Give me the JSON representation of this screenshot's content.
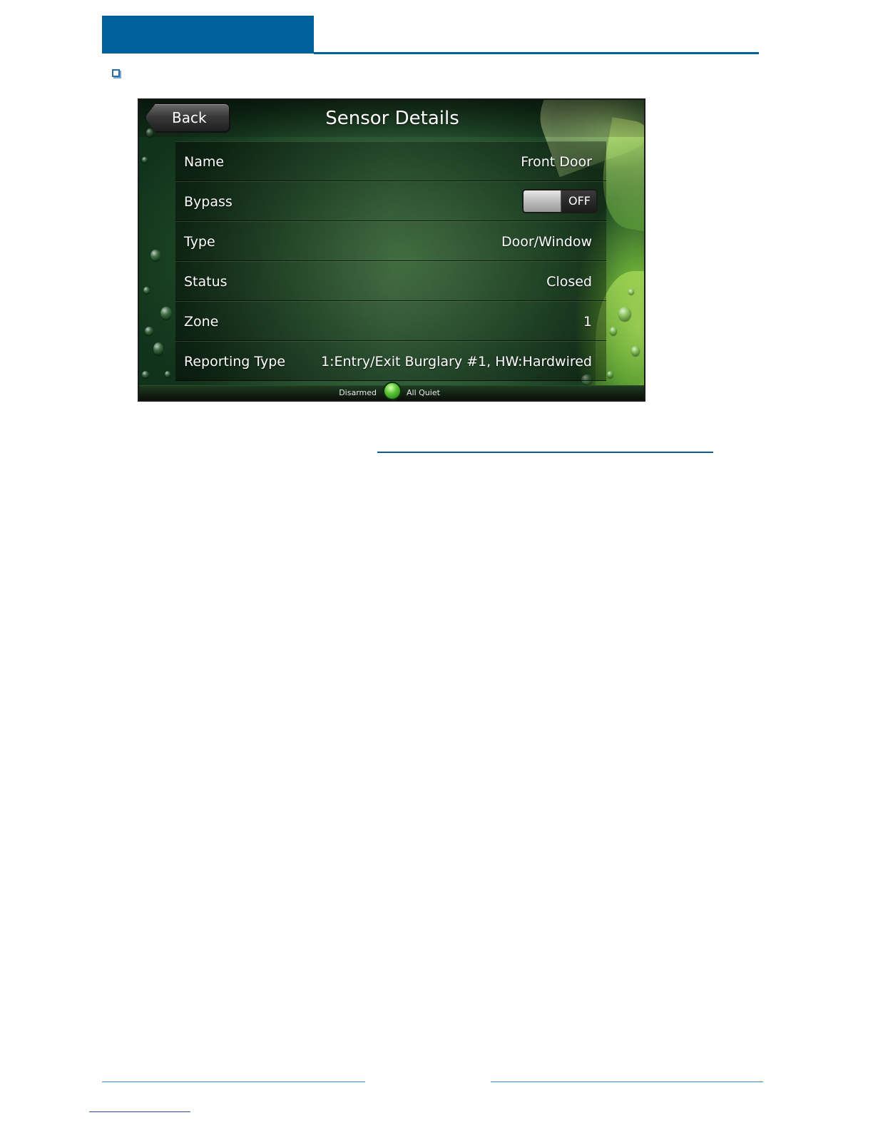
{
  "screen": {
    "title": "Sensor Details",
    "back_label": "Back",
    "rows": [
      {
        "label": "Name",
        "value": "Front Door"
      },
      {
        "label": "Bypass",
        "toggle": "OFF"
      },
      {
        "label": "Type",
        "value": "Door/Window"
      },
      {
        "label": "Status",
        "value": "Closed"
      },
      {
        "label": "Zone",
        "value": "1"
      },
      {
        "label": "Reporting Type",
        "value": "1:Entry/Exit Burglary #1, HW:Hardwired"
      }
    ],
    "status_bar": {
      "arm_state": "Disarmed",
      "condition": "All Quiet"
    }
  },
  "colors": {
    "doc_accent": "#00619a",
    "status_orb": "#5ec73a"
  }
}
